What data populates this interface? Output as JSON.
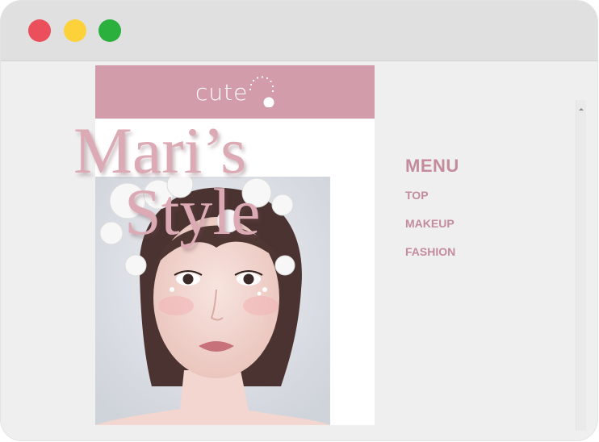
{
  "window": {
    "controls": [
      {
        "name": "close",
        "color": "#eb4f5c"
      },
      {
        "name": "minimize",
        "color": "#fdd139"
      },
      {
        "name": "maximize",
        "color": "#2bb03e"
      }
    ]
  },
  "site": {
    "logo_text": "cute",
    "header_color": "#d39cab",
    "hero_title_line1": "Mari’s",
    "hero_title_line2": "Style",
    "hero_image": "portrait-with-white-flower-crown",
    "accent_color": "#dcaab5"
  },
  "menu": {
    "title": "MENU",
    "items": [
      {
        "label": "TOP"
      },
      {
        "label": "MAKEUP"
      },
      {
        "label": "FASHION"
      }
    ],
    "color": "#c48b9d"
  }
}
